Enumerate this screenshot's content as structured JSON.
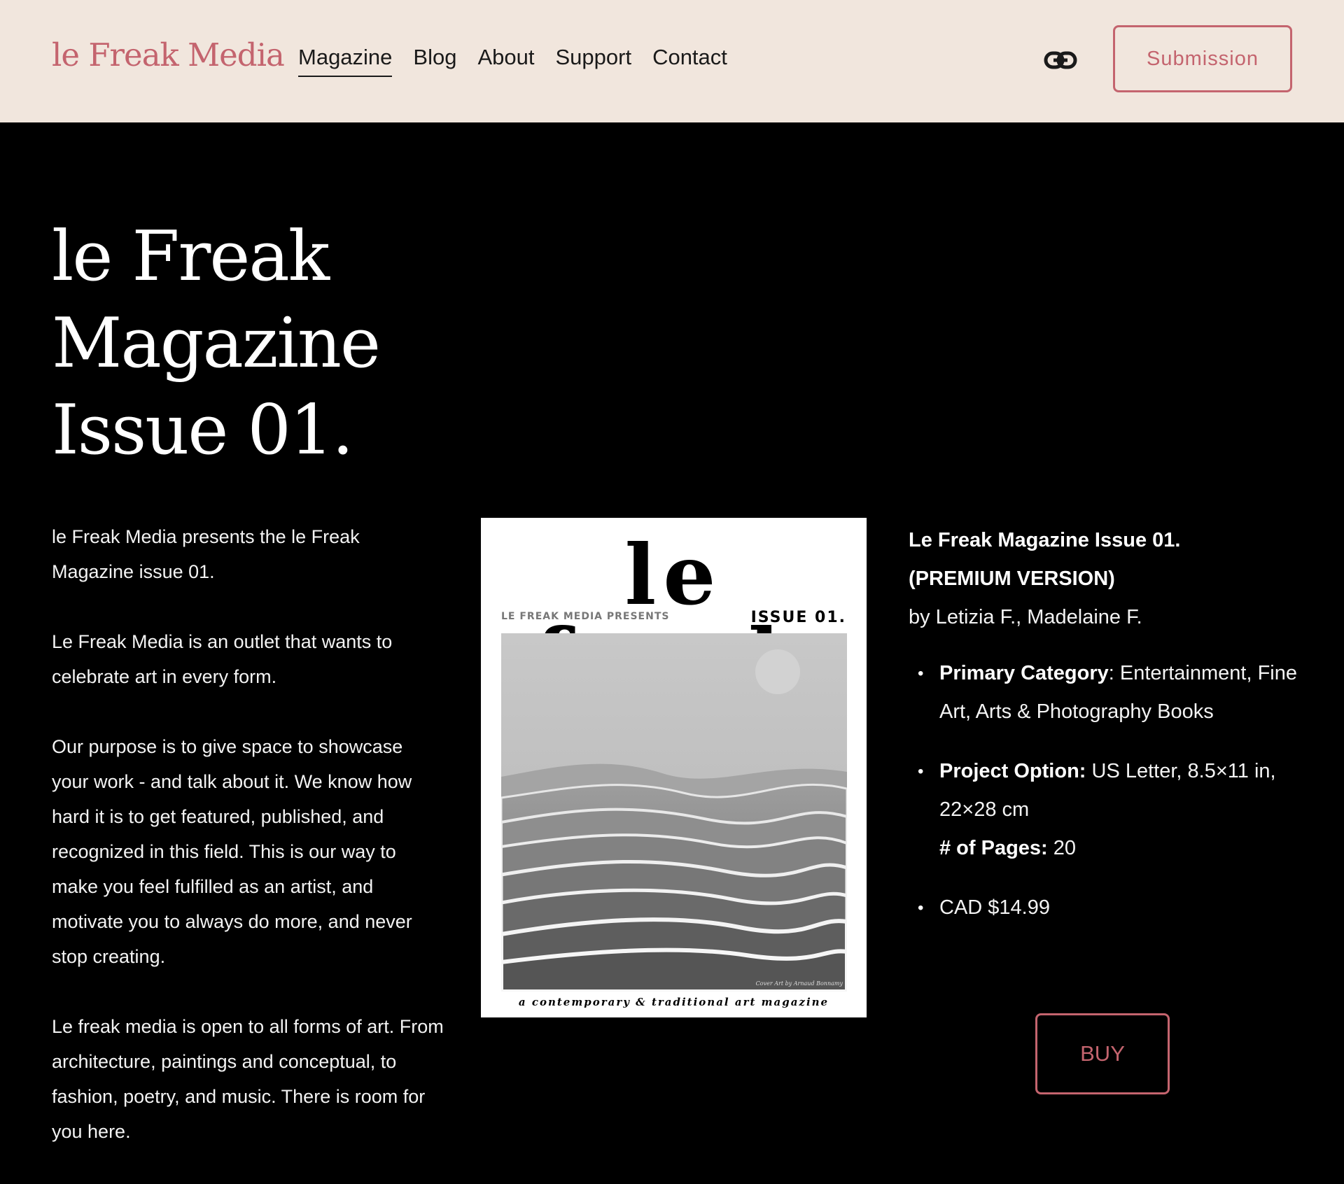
{
  "header": {
    "logo": "le Freak Media",
    "nav": [
      "Magazine",
      "Blog",
      "About",
      "Support",
      "Contact"
    ],
    "active_nav": "Magazine",
    "link_icon": "link-icon",
    "submission_label": "Submission"
  },
  "hero": {
    "title_lines": [
      "le Freak",
      "Magazine",
      "Issue 01."
    ]
  },
  "intro": {
    "paragraphs": [
      "le Freak Media presents the le Freak Magazine issue 01.",
      "Le Freak Media is an outlet that wants to celebrate art in every form.",
      "Our purpose is to give space to showcase your work - and talk about it. We know how hard it is to get featured, published, and recognized in this field. This is our way to make you feel fulfilled as an artist, and motivate you to always do more, and never stop creating.",
      "Le freak media is open to all forms of art. From architecture, paintings and conceptual, to fashion, poetry, and music. There is room for you here."
    ]
  },
  "cover": {
    "title": "le freak",
    "presents": "LE FREAK MEDIA PRESENTS",
    "issue": "ISSUE 01.",
    "credit": "Cover Art by Arnaud Bonnamy",
    "tagline": "a contemporary & traditional art magazine"
  },
  "product": {
    "title_line1": "Le Freak Magazine Issue 01.",
    "title_line2": "(PREMIUM VERSION)",
    "authors": "by Letizia F., Madelaine F.",
    "primary_category_label": "Primary Category",
    "primary_category_value": "Entertainment, Fine Art, Arts & Photography Books",
    "project_option_label": "Project Option:",
    "project_option_value": "US Letter, 8.5×11 in, 22×28 cm",
    "pages_label": "# of Pages:",
    "pages_value": "20",
    "price": "CAD $14.99",
    "buy_label": "BUY"
  },
  "colors": {
    "header_bg": "#f1e6dd",
    "accent": "#c4646e",
    "page_bg": "#000000",
    "text": "#ffffff"
  }
}
